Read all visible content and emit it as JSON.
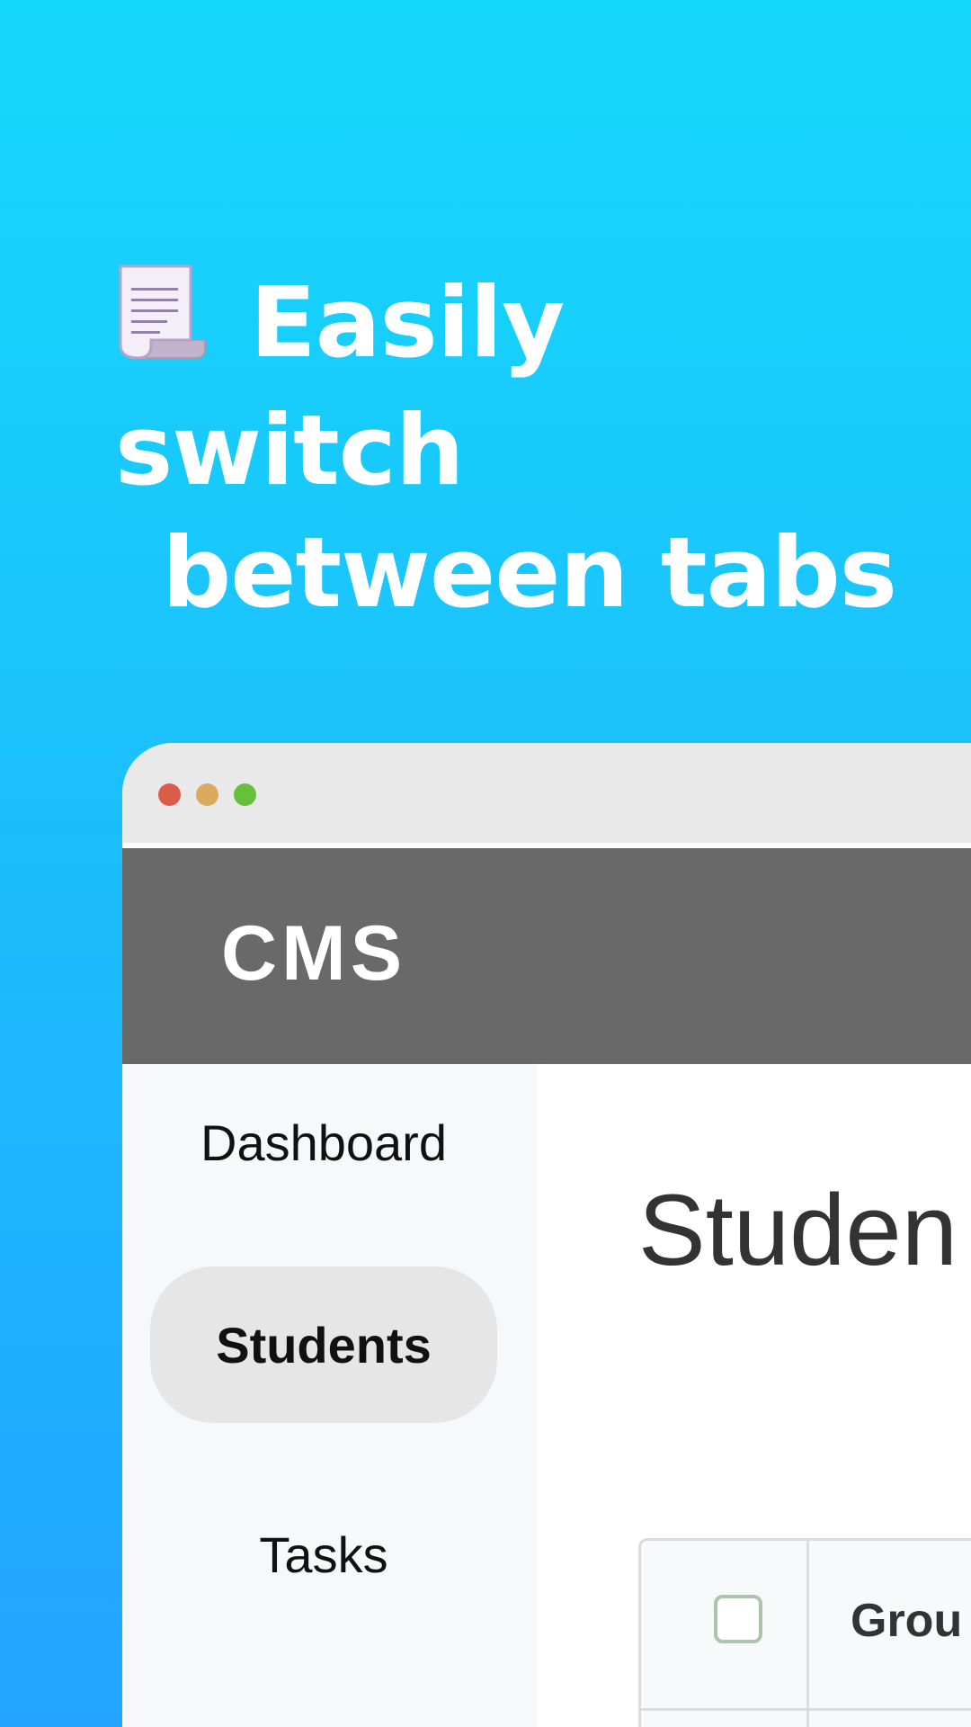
{
  "headline": {
    "line1": "Easily switch",
    "line2": "between tabs",
    "icon": "scroll-icon"
  },
  "window": {
    "controls": [
      "close-dot",
      "minimize-dot",
      "maximize-dot"
    ],
    "colors": {
      "close": "#dc5c4a",
      "minimize": "#dcaa5f",
      "maximize": "#66c03c"
    }
  },
  "app": {
    "brand": "CMS",
    "header_color": "#696969"
  },
  "sidebar": {
    "items": [
      {
        "label": "Dashboard",
        "active": false
      },
      {
        "label": "Students",
        "active": true
      },
      {
        "label": "Tasks",
        "active": false
      }
    ]
  },
  "main": {
    "title": "Studen",
    "table": {
      "select_all_checked": false,
      "headers": [
        "Grou"
      ]
    }
  },
  "colors": {
    "background_top": "#15d9fb",
    "background_bottom": "#22a4ff",
    "active_tab_bg": "#e6e6e6"
  }
}
